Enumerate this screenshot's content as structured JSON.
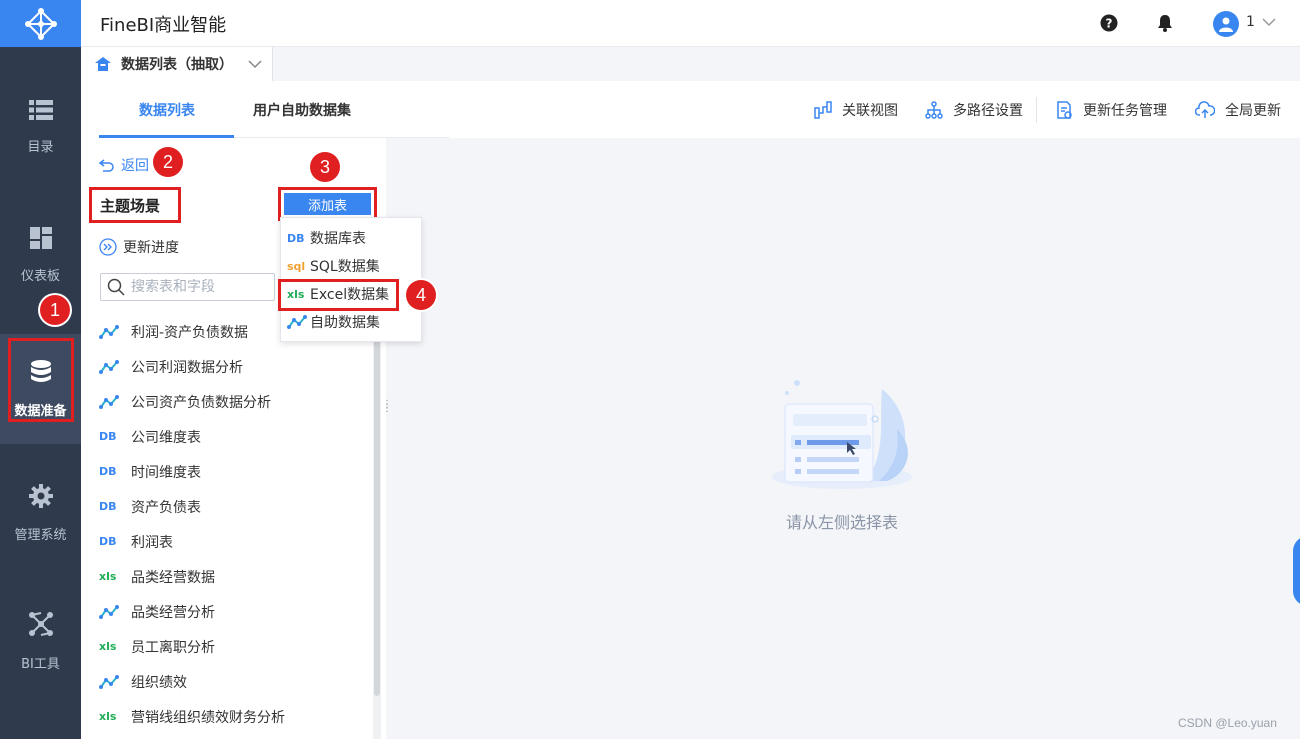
{
  "app": {
    "title": "FineBI商业智能"
  },
  "header": {
    "user_number": "1"
  },
  "nav": {
    "items": [
      {
        "label": "目录",
        "icon": "list-icon"
      },
      {
        "label": "仪表板",
        "icon": "dashboard-icon"
      },
      {
        "label": "数据准备",
        "icon": "database-icon",
        "active": true
      },
      {
        "label": "管理系统",
        "icon": "gear-icon"
      },
      {
        "label": "BI工具",
        "icon": "network-icon"
      }
    ]
  },
  "breadcrumb": {
    "label": "数据列表（抽取）"
  },
  "tabs": [
    {
      "label": "数据列表",
      "active": true
    },
    {
      "label": "用户自助数据集",
      "active": false
    }
  ],
  "toolbar": {
    "relation_view": "关联视图",
    "multi_path": "多路径设置",
    "update_task": "更新任务管理",
    "global_update": "全局更新"
  },
  "panel": {
    "back": "返回",
    "section_title": "主题场景",
    "add_table": "添加表",
    "update_progress": "更新进度",
    "search_placeholder": "搜索表和字段"
  },
  "tables": [
    {
      "name": "利润-资产负债数据",
      "type": "self"
    },
    {
      "name": "公司利润数据分析",
      "type": "self"
    },
    {
      "name": "公司资产负债数据分析",
      "type": "self"
    },
    {
      "name": "公司维度表",
      "type": "db"
    },
    {
      "name": "时间维度表",
      "type": "db"
    },
    {
      "name": "资产负债表",
      "type": "db"
    },
    {
      "name": "利润表",
      "type": "db"
    },
    {
      "name": "品类经营数据",
      "type": "xls"
    },
    {
      "name": "品类经营分析",
      "type": "self"
    },
    {
      "name": "员工离职分析",
      "type": "xls"
    },
    {
      "name": "组织绩效",
      "type": "self"
    },
    {
      "name": "营销线组织绩效财务分析",
      "type": "xls"
    }
  ],
  "dropdown": [
    {
      "label": "数据库表",
      "type": "db"
    },
    {
      "label": "SQL数据集",
      "type": "sql"
    },
    {
      "label": "Excel数据集",
      "type": "xls"
    },
    {
      "label": "自助数据集",
      "type": "self"
    }
  ],
  "icon_labels": {
    "db": "DB",
    "xls": "xls",
    "sql": "sql"
  },
  "empty_state": {
    "text": "请从左侧选择表"
  },
  "badges": [
    "1",
    "2",
    "3",
    "4"
  ],
  "watermark": "CSDN @Leo.yuan",
  "colors": {
    "accent": "#3a86f0",
    "nav_bg": "#2f3a4d",
    "highlight": "#e02020",
    "excel": "#1fae56",
    "sql": "#f0a030"
  }
}
